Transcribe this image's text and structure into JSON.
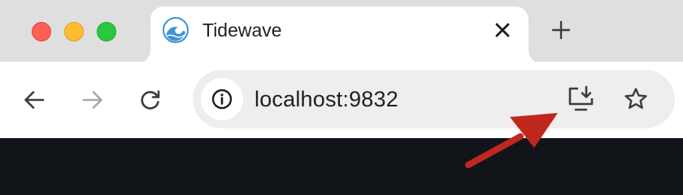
{
  "window_controls": [
    "close",
    "minimize",
    "zoom"
  ],
  "tab": {
    "title": "Tidewave",
    "favicon": "wave-logo-icon",
    "close_icon": "close-icon"
  },
  "new_tab_icon": "plus-icon",
  "toolbar": {
    "back_icon": "back-arrow-icon",
    "forward_icon": "forward-arrow-icon",
    "forward_enabled": false,
    "reload_icon": "reload-icon"
  },
  "address_bar": {
    "url": "localhost:9832",
    "site_info_icon": "info-icon",
    "install_icon": "install-app-icon",
    "bookmark_icon": "star-icon"
  },
  "annotation": {
    "type": "arrow",
    "points_to": "install-app-icon"
  },
  "colors": {
    "tab_strip": "#dfdfe0",
    "toolbar": "#ffffff",
    "omnibox": "#efeded",
    "content": "#111418",
    "icon": "#3c3c3c",
    "icon_disabled": "#a8a8a8",
    "arrow": "#c0271d",
    "close_light": "#fe5f57",
    "minimize_light": "#febc2e",
    "zoom_light": "#28c840"
  }
}
